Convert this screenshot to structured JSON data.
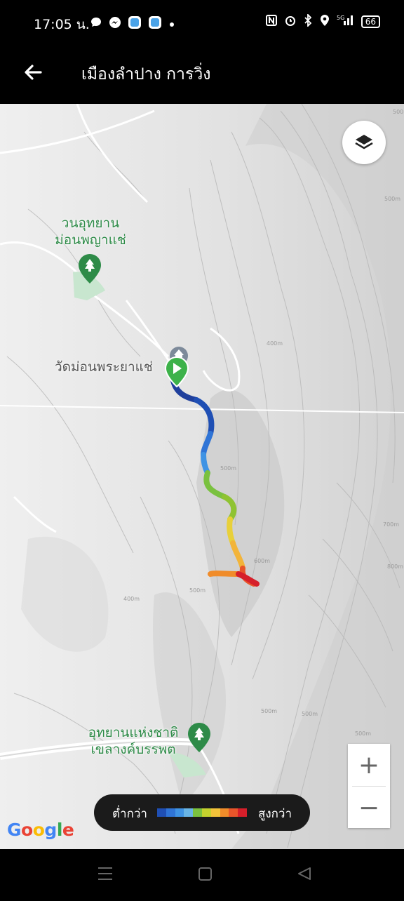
{
  "status_bar": {
    "time": "17:05 น.",
    "battery": "66",
    "network": "5G"
  },
  "header": {
    "title": "เมืองลำปาง การวิ่ง"
  },
  "map": {
    "pois": [
      {
        "label_line1": "วนอุทยาน",
        "label_line2": "ม่อนพญาแช่",
        "icon": "tree-icon"
      },
      {
        "label_line1": "อุทยานแห่งชาติ",
        "label_line2": "เขลางค์บรรพต",
        "icon": "tree-icon"
      }
    ],
    "temple_label": "วัดม่อนพระยาแช่",
    "attribution": "Google",
    "contour_labels": [
      "400m",
      "500m",
      "600m",
      "700m",
      "800m"
    ]
  },
  "legend": {
    "low_label": "ต่ำกว่า",
    "high_label": "สูงกว่า",
    "colors": [
      "#1f4fb4",
      "#2f74d6",
      "#3f93e4",
      "#69b5e6",
      "#7ac13f",
      "#c4d22e",
      "#f2c33a",
      "#f08c2a",
      "#e8552a",
      "#d61f2a"
    ]
  },
  "zoom": {
    "in_label": "+",
    "out_label": "−"
  },
  "colors": {
    "poi_green": "#2e8b48",
    "start_marker": "#3db24a",
    "end_marker": "#d9262a"
  }
}
